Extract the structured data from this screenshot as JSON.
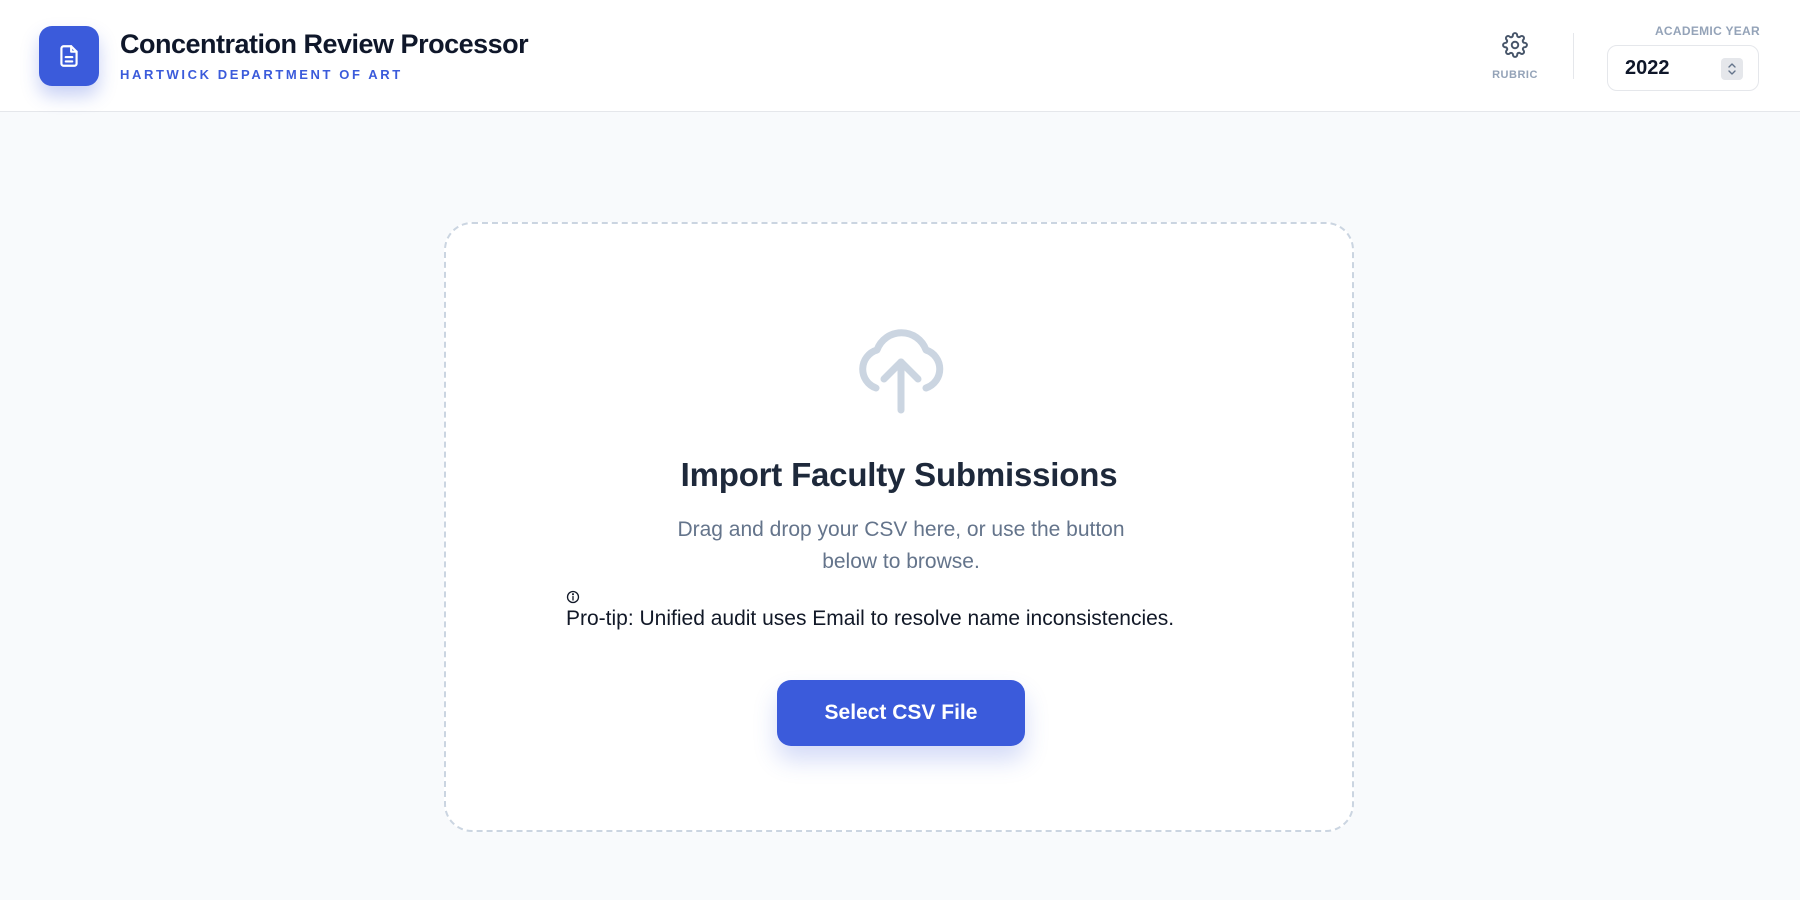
{
  "header": {
    "title": "Concentration Review Processor",
    "subtitle": "HARTWICK DEPARTMENT OF ART",
    "logo_icon": "document-icon",
    "rubric_label": "RUBRIC",
    "rubric_icon": "gear-icon",
    "year_label": "ACADEMIC YEAR",
    "year_value": "2022"
  },
  "upload": {
    "icon": "cloud-upload-icon",
    "title": "Import Faculty Submissions",
    "description": "Drag and drop your CSV here, or use the button below to browse.",
    "tip_icon": "info-icon",
    "tip": "Pro-tip: Unified audit uses Email to resolve name inconsistencies.",
    "button_label": "Select CSV File"
  },
  "colors": {
    "accent": "#3b5bdb",
    "muted_text": "#64748b",
    "label_gray": "#94a3b8",
    "border_dashed": "#cbd5e1",
    "background": "#f8fafc"
  }
}
